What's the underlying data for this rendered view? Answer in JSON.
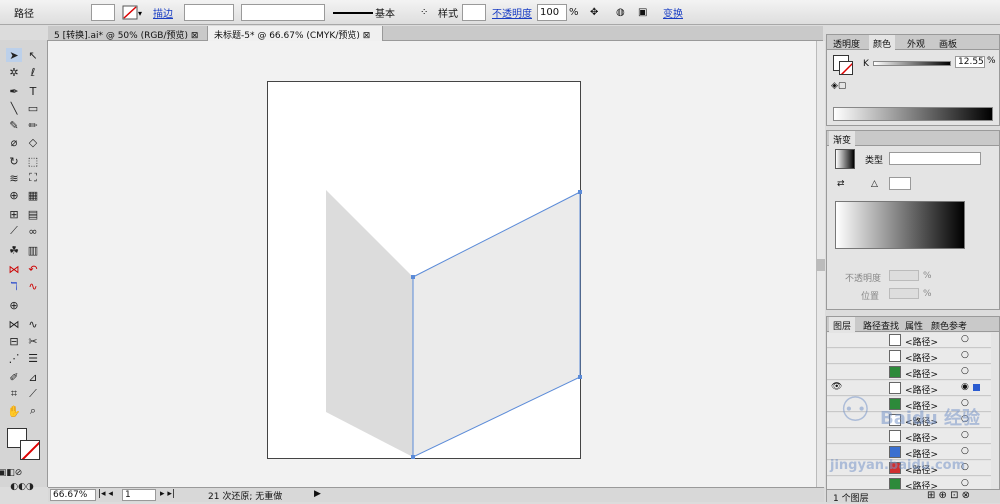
{
  "control_bar": {
    "selection_label": "路径",
    "stroke_link": "描边",
    "stroke_profile": "基本",
    "style_label": "样式",
    "opacity_link": "不透明度",
    "opacity_value": "100",
    "opacity_unit": "%",
    "transform_link": "变换"
  },
  "doc_tabs": [
    {
      "label": "5 [转换].ai* @ 50% (RGB/预览)",
      "close": "⊠"
    },
    {
      "label": "未标题-5* @ 66.67% (CMYK/预览)",
      "close": "⊠"
    }
  ],
  "color_panel": {
    "tabs": [
      "透明度",
      "颜色",
      "外观",
      "画板"
    ],
    "channel": "K",
    "value": "12.55",
    "unit": "%"
  },
  "gradient_panel": {
    "title": "渐变",
    "type_label": "类型",
    "opacity_label": "不透明度",
    "opacity_unit": "%",
    "location_label": "位置",
    "location_unit": "%"
  },
  "layers_panel": {
    "tabs": [
      "图层",
      "路径查找",
      "属性",
      "颜色参考"
    ],
    "rows": [
      "<路径>",
      "<路径>",
      "<路径>",
      "<路径>",
      "<路径>",
      "<路径>",
      "<路径>",
      "<路径>",
      "<路径>",
      "<路径>"
    ],
    "footer": "1 个图层"
  },
  "status_bar": {
    "zoom": "66.67%",
    "page": "1",
    "message": "21 次还原; 无重做"
  },
  "colors": {
    "selection": "#5b8bd8",
    "shape": "#dcdcdc",
    "shape_right": "#ebebeb"
  },
  "watermark": {
    "brand": "Baidu 经验",
    "url": "jingyan.baidu.com"
  }
}
